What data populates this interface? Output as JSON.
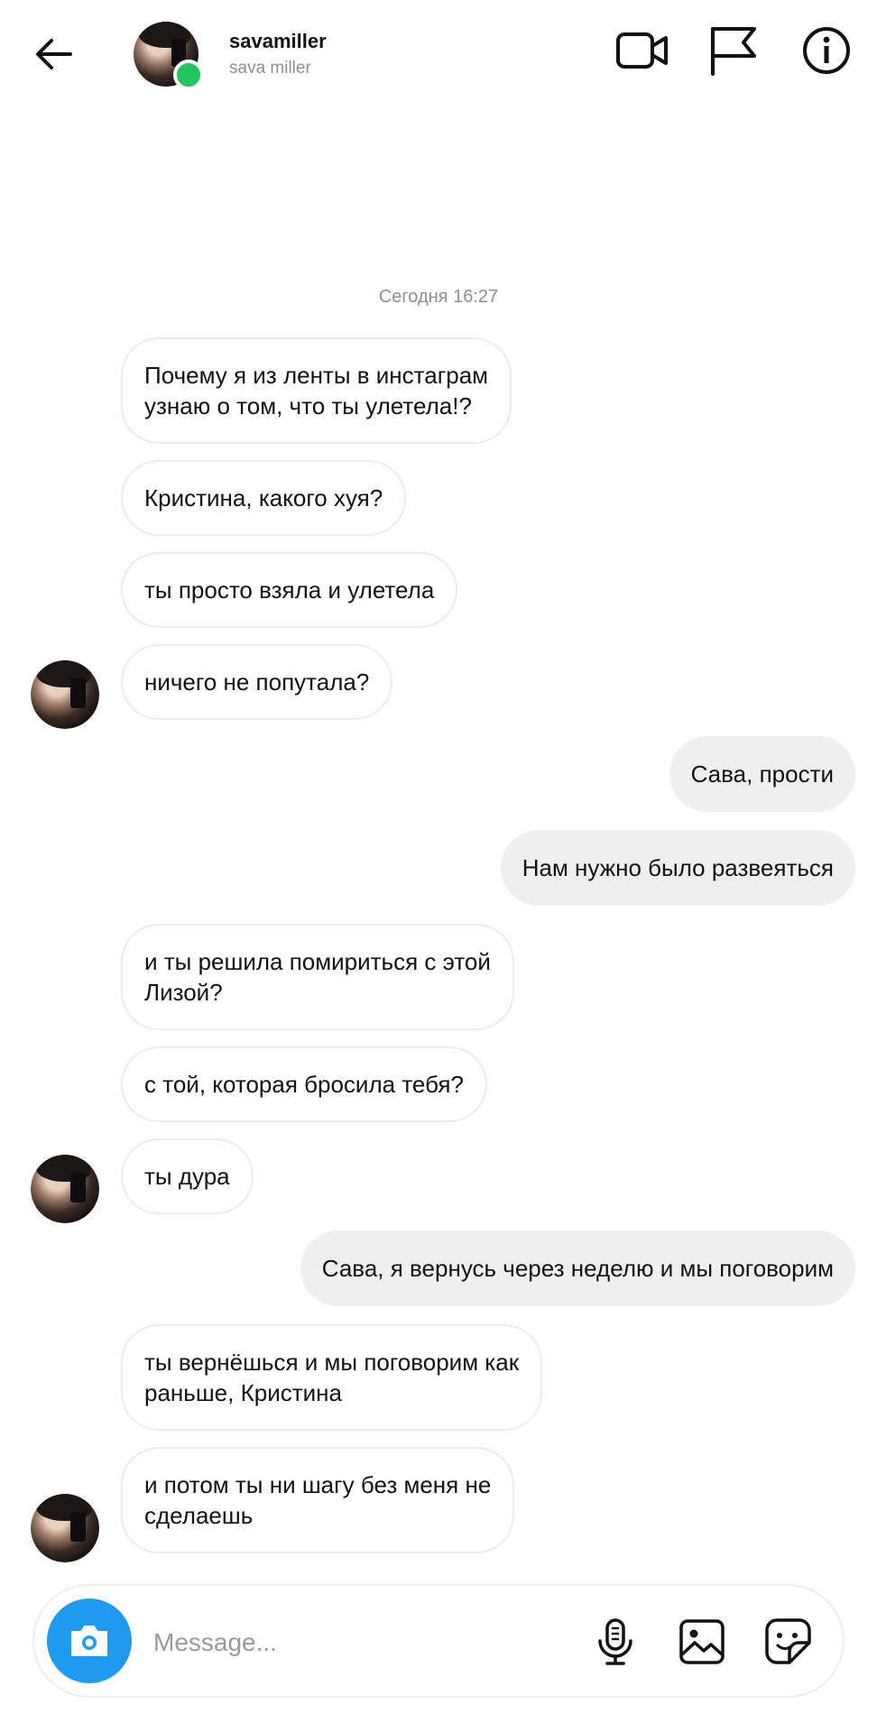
{
  "header": {
    "username": "savamiller",
    "fullname": "sava miller"
  },
  "timestamp": "Сегодня 16:27",
  "messages": [
    {
      "side": "in",
      "text": "Почему я из ленты в инстаграм\nузнаю о том, что ты улетела!?"
    },
    {
      "side": "in",
      "text": "Кристина, какого хуя?"
    },
    {
      "side": "in",
      "text": "ты просто взяла и улетела"
    },
    {
      "side": "in",
      "text": "ничего не попутала?"
    },
    {
      "side": "out",
      "text": "Сава, прости"
    },
    {
      "side": "out",
      "text": "Нам нужно было развеяться"
    },
    {
      "side": "in",
      "text": "и ты решила помириться с этой\nЛизой?"
    },
    {
      "side": "in",
      "text": "с той,  которая бросила тебя?"
    },
    {
      "side": "in",
      "text": "ты дура"
    },
    {
      "side": "out",
      "text": "Сава, я вернусь через неделю и мы поговорим"
    },
    {
      "side": "in",
      "text": "ты вернёшься и мы поговорим как\nраньше,  Кристина"
    },
    {
      "side": "in",
      "text": "и потом ты ни шагу без меня не\nсделаешь"
    }
  ],
  "composer": {
    "placeholder": "Message..."
  }
}
